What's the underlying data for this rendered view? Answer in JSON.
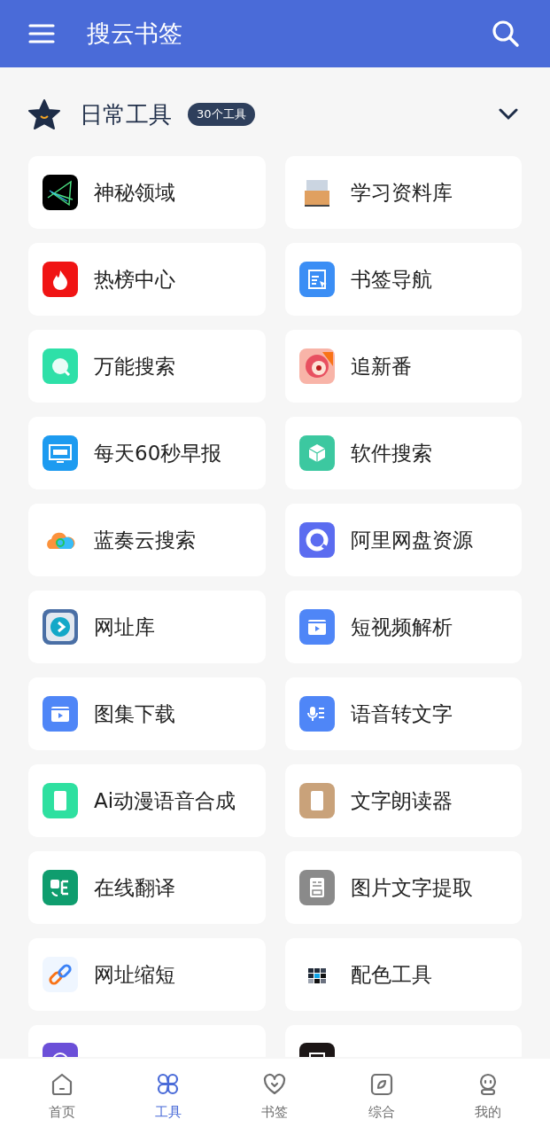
{
  "app_bar": {
    "title": "搜云书签"
  },
  "section": {
    "title": "日常工具",
    "count_badge": "30个工具",
    "expanded": true
  },
  "tools": [
    {
      "label": "神秘领域"
    },
    {
      "label": "学习资料库"
    },
    {
      "label": "热榜中心"
    },
    {
      "label": "书签导航"
    },
    {
      "label": "万能搜索"
    },
    {
      "label": "追新番"
    },
    {
      "label": "每天60秒早报"
    },
    {
      "label": "软件搜索"
    },
    {
      "label": "蓝奏云搜索"
    },
    {
      "label": "阿里网盘资源"
    },
    {
      "label": "网址库"
    },
    {
      "label": "短视频解析"
    },
    {
      "label": "图集下载"
    },
    {
      "label": "语音转文字"
    },
    {
      "label": "Ai动漫语音合成"
    },
    {
      "label": "文字朗读器"
    },
    {
      "label": "在线翻译"
    },
    {
      "label": "图片文字提取"
    },
    {
      "label": "网址缩短"
    },
    {
      "label": "配色工具"
    },
    {
      "kind": "label_hidden"
    },
    {
      "kind": "label_hidden"
    }
  ],
  "bottom_nav": [
    {
      "label": "首页",
      "selected": false
    },
    {
      "label": "工具",
      "selected": true
    },
    {
      "label": "书签",
      "selected": false
    },
    {
      "label": "综合",
      "selected": false
    },
    {
      "label": "我的",
      "selected": false
    }
  ]
}
